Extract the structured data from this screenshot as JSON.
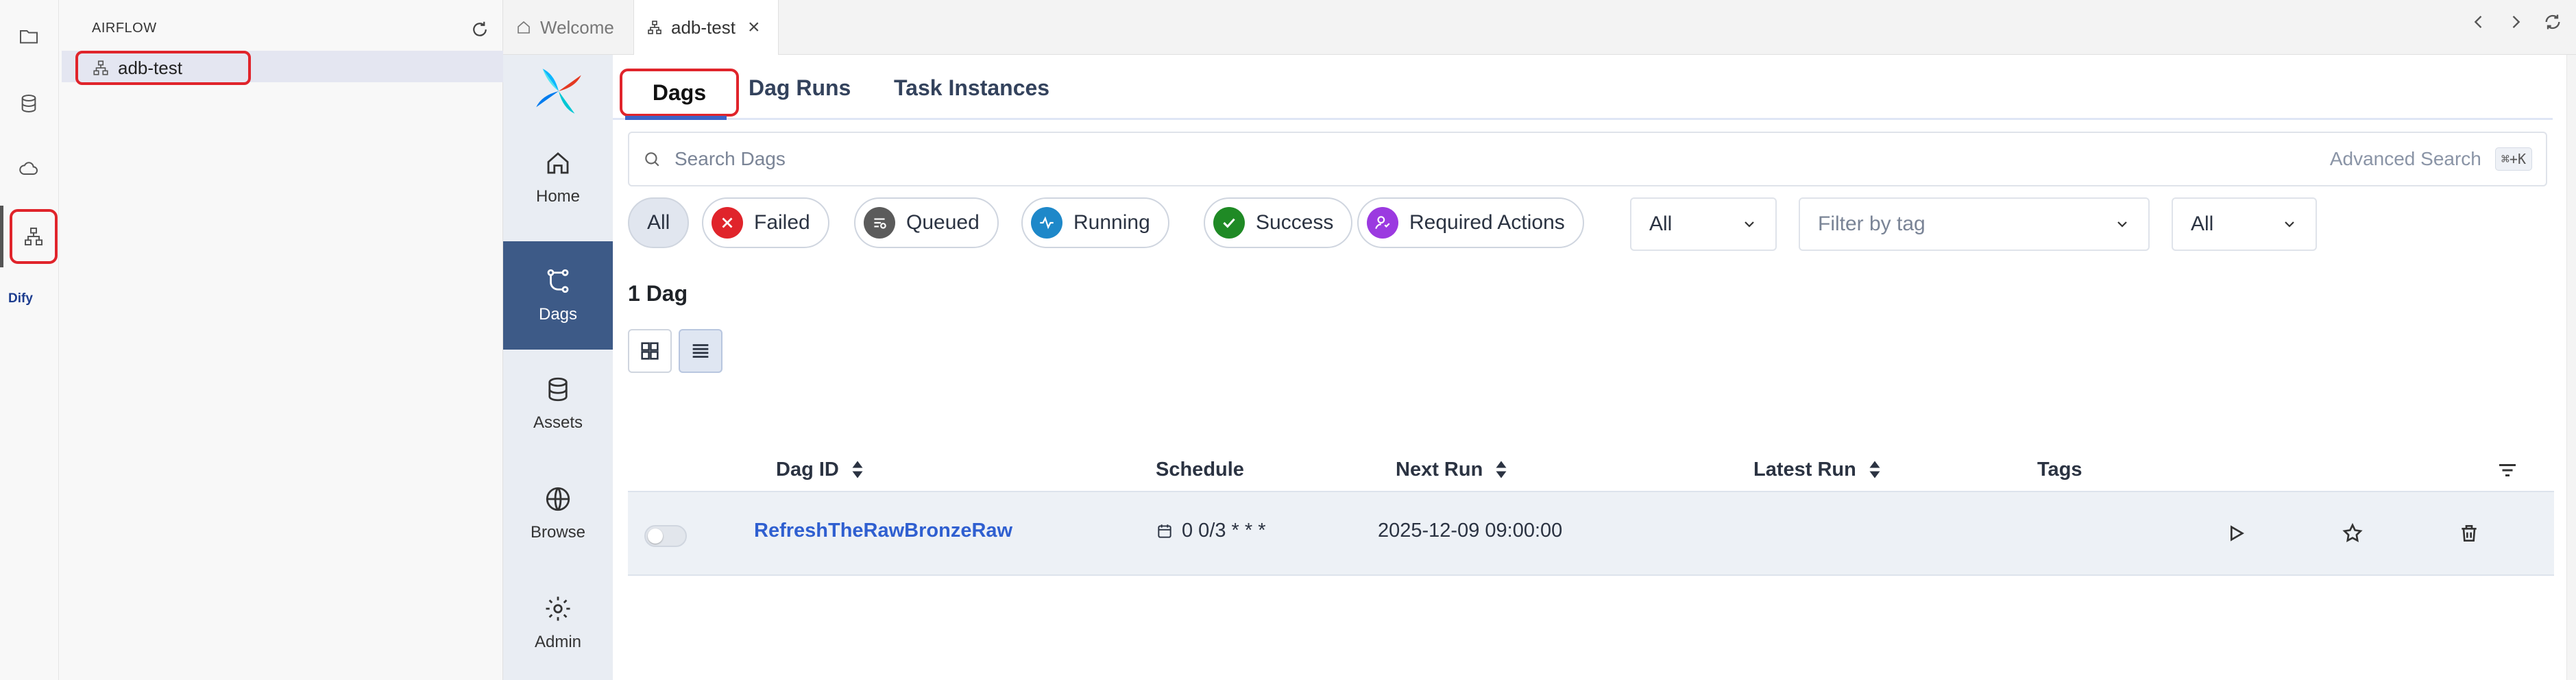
{
  "explorer": {
    "title": "AIRFLOW",
    "tree_item": "adb-test"
  },
  "activity": {
    "dify": "Dify"
  },
  "tabs": [
    {
      "label": "Welcome"
    },
    {
      "label": "adb-test"
    }
  ],
  "tab_close": "×",
  "nav": [
    {
      "label": "Home"
    },
    {
      "label": "Dags"
    },
    {
      "label": "Assets"
    },
    {
      "label": "Browse"
    },
    {
      "label": "Admin"
    }
  ],
  "main_tabs": [
    {
      "label": "Dags"
    },
    {
      "label": "Dag Runs"
    },
    {
      "label": "Task Instances"
    }
  ],
  "search": {
    "placeholder": "Search Dags",
    "advanced": "Advanced Search",
    "shortcut": "⌘+K"
  },
  "filters": {
    "chips": [
      {
        "label": "All"
      },
      {
        "label": "Failed",
        "color": "#e0242b"
      },
      {
        "label": "Queued",
        "color": "#5b5b5b"
      },
      {
        "label": "Running",
        "color": "#1e88c9"
      },
      {
        "label": "Success",
        "color": "#1f8a25"
      },
      {
        "label": "Required Actions",
        "color": "#9b3ae0"
      }
    ],
    "select_1": "All",
    "tag_placeholder": "Filter by tag",
    "select_2": "All"
  },
  "count": "1 Dag",
  "table": {
    "headers": {
      "dag_id": "Dag ID",
      "schedule": "Schedule",
      "next_run": "Next Run",
      "latest_run": "Latest Run",
      "tags": "Tags"
    },
    "rows": [
      {
        "dag_id": "RefreshTheRawBronzeRaw",
        "schedule": "0 0/3 * * *",
        "next_run": "2025-12-09 09:00:00"
      }
    ]
  }
}
